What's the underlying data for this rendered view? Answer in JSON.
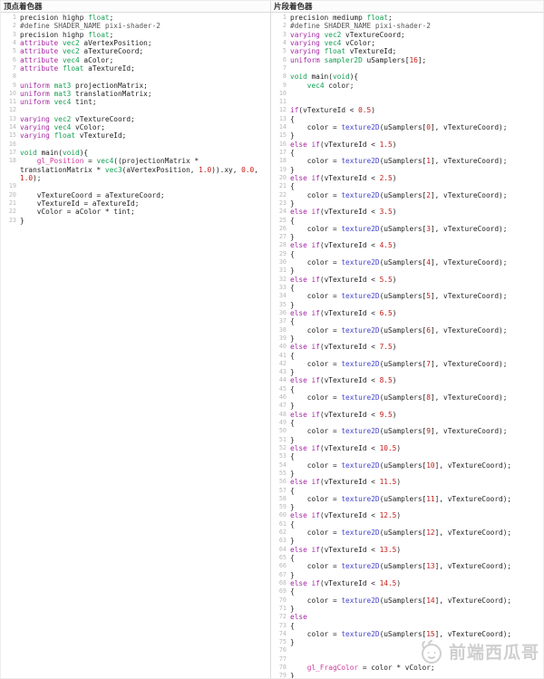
{
  "colors": {
    "k": "#a626a4",
    "t": "#14a053",
    "n": "#c41a16",
    "a": "#d5379d",
    "b": "#4745cb",
    "m": "#555555",
    "plain": "#1e1e1e",
    "ln": "#b8b8b8",
    "border": "#dcdcdc",
    "header": "#2b2b2b",
    "wm": "#c7c7c7"
  },
  "watermark": {
    "text": "前端西瓜哥"
  },
  "panels": [
    {
      "title": "顶点着色器",
      "lines": [
        [
          "precision highp ",
          [
            "float",
            "t"
          ],
          ";"
        ],
        [
          [
            "#define SHADER_NAME pixi-shader-2",
            "m"
          ]
        ],
        [
          "precision highp ",
          [
            "float",
            "t"
          ],
          ";"
        ],
        [
          [
            "attribute",
            "k"
          ],
          " ",
          [
            "vec2",
            "t"
          ],
          " aVertexPosition;"
        ],
        [
          [
            "attribute",
            "k"
          ],
          " ",
          [
            "vec2",
            "t"
          ],
          " aTextureCoord;"
        ],
        [
          [
            "attribute",
            "k"
          ],
          " ",
          [
            "vec4",
            "t"
          ],
          " aColor;"
        ],
        [
          [
            "attribute",
            "k"
          ],
          " ",
          [
            "float",
            "t"
          ],
          " aTextureId;"
        ],
        [],
        [
          [
            "uniform",
            "k"
          ],
          " ",
          [
            "mat3",
            "t"
          ],
          " projectionMatrix;"
        ],
        [
          [
            "uniform",
            "k"
          ],
          " ",
          [
            "mat3",
            "t"
          ],
          " translationMatrix;"
        ],
        [
          [
            "uniform",
            "k"
          ],
          " ",
          [
            "vec4",
            "t"
          ],
          " tint;"
        ],
        [],
        [
          [
            "varying",
            "k"
          ],
          " ",
          [
            "vec2",
            "t"
          ],
          " vTextureCoord;"
        ],
        [
          [
            "varying",
            "k"
          ],
          " ",
          [
            "vec4",
            "t"
          ],
          " vColor;"
        ],
        [
          [
            "varying",
            "k"
          ],
          " ",
          [
            "float",
            "t"
          ],
          " vTextureId;"
        ],
        [],
        [
          [
            "void",
            "t"
          ],
          " main(",
          [
            "void",
            "t"
          ],
          "){"
        ],
        [
          "    ",
          [
            "gl_Position",
            "a"
          ],
          " = ",
          [
            "vec4",
            "t"
          ],
          "((projectionMatrix * translationMatrix * ",
          [
            "vec3",
            "t"
          ],
          "(aVertexPosition, ",
          [
            "1.0",
            "n"
          ],
          ")).xy, ",
          [
            "0.0",
            "n"
          ],
          ", ",
          [
            "1.0",
            "n"
          ],
          ");"
        ],
        [],
        [
          "    vTextureCoord = aTextureCoord;"
        ],
        [
          "    vTextureId = aTextureId;"
        ],
        [
          "    vColor = aColor * tint;"
        ],
        [
          "}"
        ]
      ]
    },
    {
      "title": "片段着色器",
      "lines": [
        [
          "precision mediump ",
          [
            "float",
            "t"
          ],
          ";"
        ],
        [
          [
            "#define SHADER_NAME pixi-shader-2",
            "m"
          ]
        ],
        [
          [
            "varying",
            "k"
          ],
          " ",
          [
            "vec2",
            "t"
          ],
          " vTextureCoord;"
        ],
        [
          [
            "varying",
            "k"
          ],
          " ",
          [
            "vec4",
            "t"
          ],
          " vColor;"
        ],
        [
          [
            "varying",
            "k"
          ],
          " ",
          [
            "float",
            "t"
          ],
          " vTextureId;"
        ],
        [
          [
            "uniform",
            "k"
          ],
          " ",
          [
            "sampler2D",
            "t"
          ],
          " uSamplers[",
          [
            "16",
            "n"
          ],
          "];"
        ],
        [],
        [
          [
            "void",
            "t"
          ],
          " main(",
          [
            "void",
            "t"
          ],
          "){"
        ],
        [
          "    ",
          [
            "vec4",
            "t"
          ],
          " color;"
        ],
        [],
        [],
        [
          [
            "if",
            "k"
          ],
          "(vTextureId < ",
          [
            "0.5",
            "n"
          ],
          ")"
        ],
        [
          "{"
        ],
        [
          "    color = ",
          [
            "texture2D",
            "b"
          ],
          "(uSamplers[",
          [
            "0",
            "n"
          ],
          "], vTextureCoord);"
        ],
        [
          "}"
        ],
        [
          [
            "else",
            "k"
          ],
          " ",
          [
            "if",
            "k"
          ],
          "(vTextureId < ",
          [
            "1.5",
            "n"
          ],
          ")"
        ],
        [
          "{"
        ],
        [
          "    color = ",
          [
            "texture2D",
            "b"
          ],
          "(uSamplers[",
          [
            "1",
            "n"
          ],
          "], vTextureCoord);"
        ],
        [
          "}"
        ],
        [
          [
            "else",
            "k"
          ],
          " ",
          [
            "if",
            "k"
          ],
          "(vTextureId < ",
          [
            "2.5",
            "n"
          ],
          ")"
        ],
        [
          "{"
        ],
        [
          "    color = ",
          [
            "texture2D",
            "b"
          ],
          "(uSamplers[",
          [
            "2",
            "n"
          ],
          "], vTextureCoord);"
        ],
        [
          "}"
        ],
        [
          [
            "else",
            "k"
          ],
          " ",
          [
            "if",
            "k"
          ],
          "(vTextureId < ",
          [
            "3.5",
            "n"
          ],
          ")"
        ],
        [
          "{"
        ],
        [
          "    color = ",
          [
            "texture2D",
            "b"
          ],
          "(uSamplers[",
          [
            "3",
            "n"
          ],
          "], vTextureCoord);"
        ],
        [
          "}"
        ],
        [
          [
            "else",
            "k"
          ],
          " ",
          [
            "if",
            "k"
          ],
          "(vTextureId < ",
          [
            "4.5",
            "n"
          ],
          ")"
        ],
        [
          "{"
        ],
        [
          "    color = ",
          [
            "texture2D",
            "b"
          ],
          "(uSamplers[",
          [
            "4",
            "n"
          ],
          "], vTextureCoord);"
        ],
        [
          "}"
        ],
        [
          [
            "else",
            "k"
          ],
          " ",
          [
            "if",
            "k"
          ],
          "(vTextureId < ",
          [
            "5.5",
            "n"
          ],
          ")"
        ],
        [
          "{"
        ],
        [
          "    color = ",
          [
            "texture2D",
            "b"
          ],
          "(uSamplers[",
          [
            "5",
            "n"
          ],
          "], vTextureCoord);"
        ],
        [
          "}"
        ],
        [
          [
            "else",
            "k"
          ],
          " ",
          [
            "if",
            "k"
          ],
          "(vTextureId < ",
          [
            "6.5",
            "n"
          ],
          ")"
        ],
        [
          "{"
        ],
        [
          "    color = ",
          [
            "texture2D",
            "b"
          ],
          "(uSamplers[",
          [
            "6",
            "n"
          ],
          "], vTextureCoord);"
        ],
        [
          "}"
        ],
        [
          [
            "else",
            "k"
          ],
          " ",
          [
            "if",
            "k"
          ],
          "(vTextureId < ",
          [
            "7.5",
            "n"
          ],
          ")"
        ],
        [
          "{"
        ],
        [
          "    color = ",
          [
            "texture2D",
            "b"
          ],
          "(uSamplers[",
          [
            "7",
            "n"
          ],
          "], vTextureCoord);"
        ],
        [
          "}"
        ],
        [
          [
            "else",
            "k"
          ],
          " ",
          [
            "if",
            "k"
          ],
          "(vTextureId < ",
          [
            "8.5",
            "n"
          ],
          ")"
        ],
        [
          "{"
        ],
        [
          "    color = ",
          [
            "texture2D",
            "b"
          ],
          "(uSamplers[",
          [
            "8",
            "n"
          ],
          "], vTextureCoord);"
        ],
        [
          "}"
        ],
        [
          [
            "else",
            "k"
          ],
          " ",
          [
            "if",
            "k"
          ],
          "(vTextureId < ",
          [
            "9.5",
            "n"
          ],
          ")"
        ],
        [
          "{"
        ],
        [
          "    color = ",
          [
            "texture2D",
            "b"
          ],
          "(uSamplers[",
          [
            "9",
            "n"
          ],
          "], vTextureCoord);"
        ],
        [
          "}"
        ],
        [
          [
            "else",
            "k"
          ],
          " ",
          [
            "if",
            "k"
          ],
          "(vTextureId < ",
          [
            "10.5",
            "n"
          ],
          ")"
        ],
        [
          "{"
        ],
        [
          "    color = ",
          [
            "texture2D",
            "b"
          ],
          "(uSamplers[",
          [
            "10",
            "n"
          ],
          "], vTextureCoord);"
        ],
        [
          "}"
        ],
        [
          [
            "else",
            "k"
          ],
          " ",
          [
            "if",
            "k"
          ],
          "(vTextureId < ",
          [
            "11.5",
            "n"
          ],
          ")"
        ],
        [
          "{"
        ],
        [
          "    color = ",
          [
            "texture2D",
            "b"
          ],
          "(uSamplers[",
          [
            "11",
            "n"
          ],
          "], vTextureCoord);"
        ],
        [
          "}"
        ],
        [
          [
            "else",
            "k"
          ],
          " ",
          [
            "if",
            "k"
          ],
          "(vTextureId < ",
          [
            "12.5",
            "n"
          ],
          ")"
        ],
        [
          "{"
        ],
        [
          "    color = ",
          [
            "texture2D",
            "b"
          ],
          "(uSamplers[",
          [
            "12",
            "n"
          ],
          "], vTextureCoord);"
        ],
        [
          "}"
        ],
        [
          [
            "else",
            "k"
          ],
          " ",
          [
            "if",
            "k"
          ],
          "(vTextureId < ",
          [
            "13.5",
            "n"
          ],
          ")"
        ],
        [
          "{"
        ],
        [
          "    color = ",
          [
            "texture2D",
            "b"
          ],
          "(uSamplers[",
          [
            "13",
            "n"
          ],
          "], vTextureCoord);"
        ],
        [
          "}"
        ],
        [
          [
            "else",
            "k"
          ],
          " ",
          [
            "if",
            "k"
          ],
          "(vTextureId < ",
          [
            "14.5",
            "n"
          ],
          ")"
        ],
        [
          "{"
        ],
        [
          "    color = ",
          [
            "texture2D",
            "b"
          ],
          "(uSamplers[",
          [
            "14",
            "n"
          ],
          "], vTextureCoord);"
        ],
        [
          "}"
        ],
        [
          [
            "else",
            "k"
          ]
        ],
        [
          "{"
        ],
        [
          "    color = ",
          [
            "texture2D",
            "b"
          ],
          "(uSamplers[",
          [
            "15",
            "n"
          ],
          "], vTextureCoord);"
        ],
        [
          "}"
        ],
        [],
        [],
        [
          "    ",
          [
            "gl_FragColor",
            "a"
          ],
          " = color * vColor;"
        ],
        [
          "}"
        ]
      ]
    }
  ]
}
